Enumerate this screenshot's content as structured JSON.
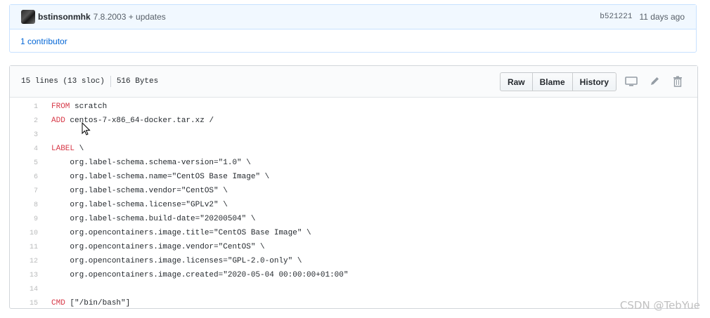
{
  "commit": {
    "author": "bstinsonmhk",
    "message": "7.8.2003 + updates",
    "sha": "b521221",
    "ago": "11 days ago",
    "contributors": "1 contributor"
  },
  "file": {
    "lines_info": "15 lines (13 sloc)",
    "size": "516 Bytes",
    "buttons": {
      "raw": "Raw",
      "blame": "Blame",
      "history": "History"
    }
  },
  "code_lines": [
    {
      "n": "1",
      "kw": "FROM",
      "rest": " scratch"
    },
    {
      "n": "2",
      "kw": "ADD",
      "rest": " centos-7-x86_64-docker.tar.xz /"
    },
    {
      "n": "3",
      "kw": "",
      "rest": ""
    },
    {
      "n": "4",
      "kw": "LABEL",
      "rest": " \\"
    },
    {
      "n": "5",
      "kw": "",
      "rest": "    org.label-schema.schema-version=\"1.0\" \\"
    },
    {
      "n": "6",
      "kw": "",
      "rest": "    org.label-schema.name=\"CentOS Base Image\" \\"
    },
    {
      "n": "7",
      "kw": "",
      "rest": "    org.label-schema.vendor=\"CentOS\" \\"
    },
    {
      "n": "8",
      "kw": "",
      "rest": "    org.label-schema.license=\"GPLv2\" \\"
    },
    {
      "n": "9",
      "kw": "",
      "rest": "    org.label-schema.build-date=\"20200504\" \\"
    },
    {
      "n": "10",
      "kw": "",
      "rest": "    org.opencontainers.image.title=\"CentOS Base Image\" \\"
    },
    {
      "n": "11",
      "kw": "",
      "rest": "    org.opencontainers.image.vendor=\"CentOS\" \\"
    },
    {
      "n": "12",
      "kw": "",
      "rest": "    org.opencontainers.image.licenses=\"GPL-2.0-only\" \\"
    },
    {
      "n": "13",
      "kw": "",
      "rest": "    org.opencontainers.image.created=\"2020-05-04 00:00:00+01:00\""
    },
    {
      "n": "14",
      "kw": "",
      "rest": ""
    },
    {
      "n": "15",
      "kw": "CMD",
      "rest": " [\"/bin/bash\"]"
    }
  ],
  "watermark": "CSDN @TebYue",
  "icons": [
    "avatar",
    "desktop-icon",
    "pencil-icon",
    "trash-icon",
    "mouse-cursor-icon"
  ]
}
